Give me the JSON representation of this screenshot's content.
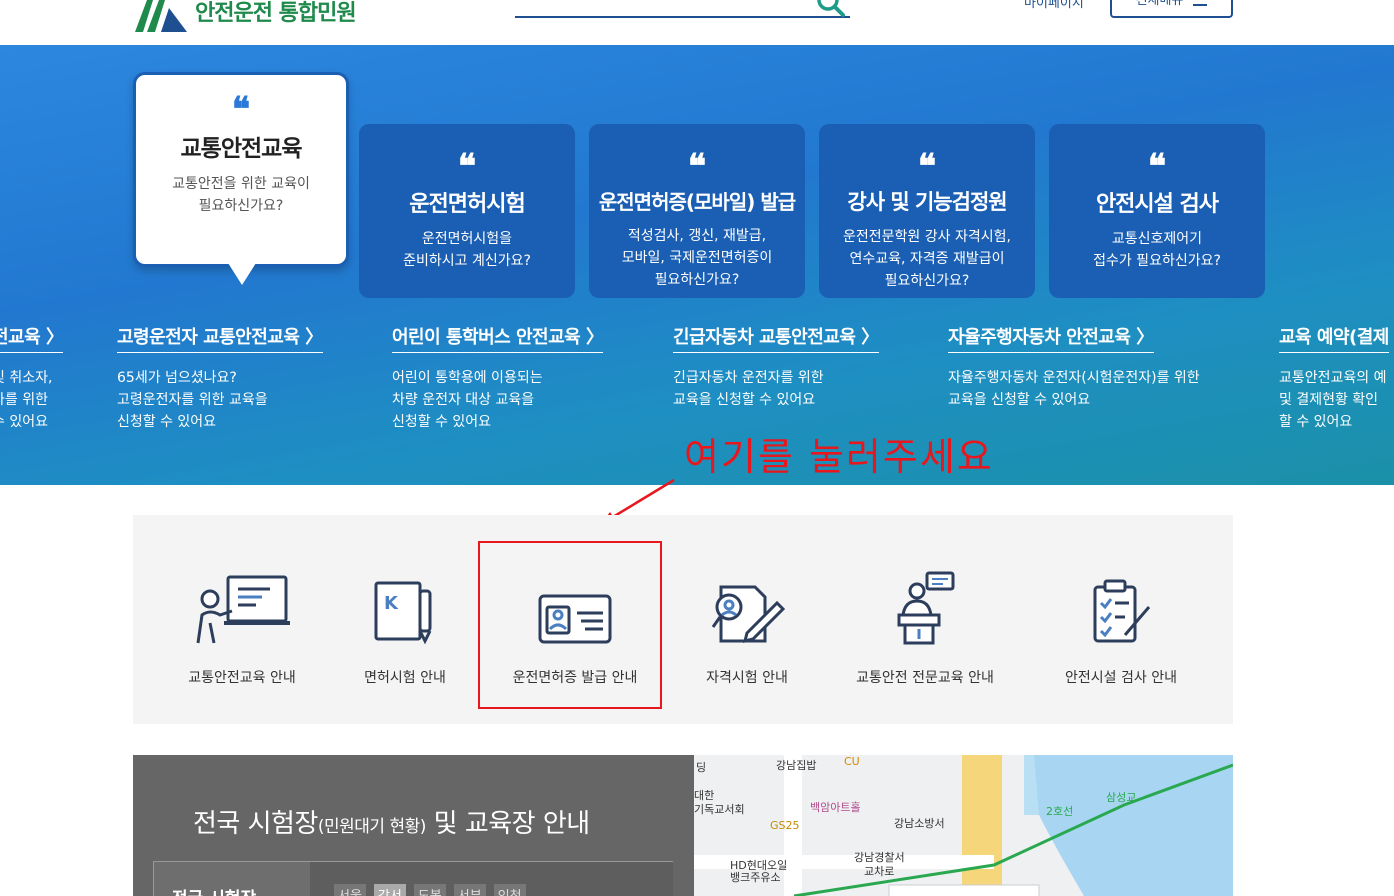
{
  "header": {
    "logo_text": "안전운전 통합민원",
    "mypage": "마이페이지",
    "all_menu": "전체메뉴"
  },
  "banner": {
    "cards": [
      {
        "title": "교통안전교육",
        "desc1": "교통안전을 위한 교육이",
        "desc2": "필요하신가요?",
        "desc3": ""
      },
      {
        "title": "운전면허시험",
        "desc1": "운전면허시험을",
        "desc2": "준비하시고 계신가요?",
        "desc3": ""
      },
      {
        "title": "운전면허증(모바일) 발급",
        "desc1": "적성검사, 갱신, 재발급,",
        "desc2": "모바일, 국제운전면허증이",
        "desc3": "필요하신가요?"
      },
      {
        "title": "강사 및 기능검정원",
        "desc1": "운전전문학원 강사 자격시험,",
        "desc2": "연수교육, 자격증 재발급이",
        "desc3": "필요하신가요?"
      },
      {
        "title": "안전시설 검사",
        "desc1": "교통신호제어기",
        "desc2": "접수가 필요하신가요?",
        "desc3": ""
      }
    ],
    "quote_mark": "❝",
    "sub_items": [
      {
        "title": "전교육 〉",
        "l1": "및 취소자,",
        "l2": "자를 위한",
        "l3": "수 있어요"
      },
      {
        "title": "고령운전자 교통안전교육 〉",
        "l1": "65세가 넘으셨나요?",
        "l2": "고령운전자를 위한 교육을",
        "l3": "신청할 수 있어요"
      },
      {
        "title": "어린이 통학버스 안전교육 〉",
        "l1": "어린이 통학용에 이용되는",
        "l2": "차량 운전자 대상 교육을",
        "l3": "신청할 수 있어요"
      },
      {
        "title": "긴급자동차 교통안전교육 〉",
        "l1": "긴급자동차 운전자를 위한",
        "l2": "교육을 신청할 수 있어요",
        "l3": ""
      },
      {
        "title": "자율주행자동차 안전교육 〉",
        "l1": "자율주행자동차 운전자(시험운전자)를 위한",
        "l2": "교육을 신청할 수 있어요",
        "l3": ""
      },
      {
        "title": "교육 예약(결제",
        "l1": "교통안전교육의 예",
        "l2": "및 결제현황 확인",
        "l3": "할 수 있어요"
      }
    ]
  },
  "annotation": "여기를 눌러주세요",
  "quick_menu": [
    {
      "label": "교통안전교육 안내",
      "icon": "presentation-icon"
    },
    {
      "label": "면허시험 안내",
      "icon": "test-paper-icon"
    },
    {
      "label": "운전면허증 발급 안내",
      "icon": "id-card-icon"
    },
    {
      "label": "자격시험 안내",
      "icon": "certificate-icon"
    },
    {
      "label": "교통안전 전문교육 안내",
      "icon": "lecture-icon"
    },
    {
      "label": "안전시설 검사 안내",
      "icon": "checklist-icon"
    }
  ],
  "bottom": {
    "title_main": "전국 시험장",
    "title_small": "(민원대기 현황)",
    "title_rest": " 및 교육장 안내",
    "box_label": "전국 시험장",
    "tabs": [
      "서울",
      "강서",
      "강서",
      "도봉",
      "서부",
      "인천",
      "인천"
    ]
  },
  "map": {
    "labels": [
      "강남집밥",
      "CU",
      "대한",
      "기독교서회",
      "백암아트홀",
      "GS25",
      "강남소방서",
      "HD현대오일",
      "뱅크주유소",
      "강남경찰서",
      "교차로",
      "2호선",
      "삼성교",
      "딩"
    ]
  },
  "colors": {
    "primary": "#1a5fb4",
    "brand_green": "#1f8a4c",
    "annotation_red": "#e8171d"
  }
}
